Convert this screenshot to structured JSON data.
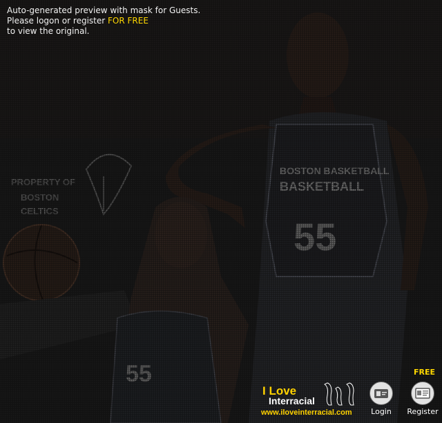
{
  "notice": {
    "line1": "Auto-generated preview with mask for Guests.",
    "line2_prefix": "Please logon or register ",
    "line2_highlight": "FOR FREE",
    "line3": "to view the original."
  },
  "photo": {
    "poster_text": [
      "PROPERTY OF",
      "BOSTON",
      "CELTICS"
    ],
    "jersey_man_lines": [
      "BOSTON BASKETBALL",
      "BASKETBALL"
    ],
    "jersey_number": "55",
    "jersey_woman_number": "55"
  },
  "brand": {
    "line1": "I Love",
    "line2": "Interracial",
    "url": "www.iloveinterracial.com"
  },
  "actions": {
    "login_label": "Login",
    "register_label": "Register",
    "free_label": "FREE"
  },
  "colors": {
    "highlight": "#ffd800",
    "text": "#f2f2f2"
  },
  "icons": {
    "login": "login-card-icon",
    "register": "register-card-icon",
    "brand": "footprints-icon"
  }
}
